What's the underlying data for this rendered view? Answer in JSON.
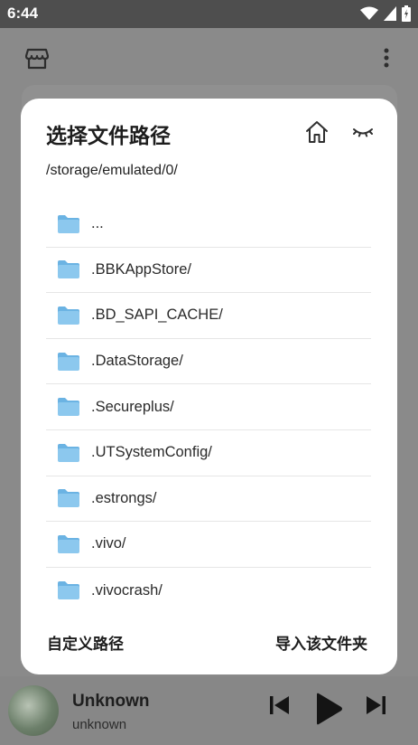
{
  "status_bar": {
    "time": "6:44"
  },
  "dialog": {
    "title": "选择文件路径",
    "current_path": "/storage/emulated/0/",
    "items": [
      {
        "label": "..."
      },
      {
        "label": ".BBKAppStore/"
      },
      {
        "label": ".BD_SAPI_CACHE/"
      },
      {
        "label": ".DataStorage/"
      },
      {
        "label": ".Secureplus/"
      },
      {
        "label": ".UTSystemConfig/"
      },
      {
        "label": ".estrongs/"
      },
      {
        "label": ".vivo/"
      },
      {
        "label": ".vivocrash/"
      }
    ],
    "custom_path_label": "自定义路径",
    "import_folder_label": "导入该文件夹"
  },
  "player": {
    "title": "Unknown",
    "artist": "unknown"
  },
  "colors": {
    "folder": "#8cc8ee",
    "folder_tab": "#6bb3e3",
    "dialog_bg": "#ffffff",
    "scrim": "#8a8a8a"
  }
}
